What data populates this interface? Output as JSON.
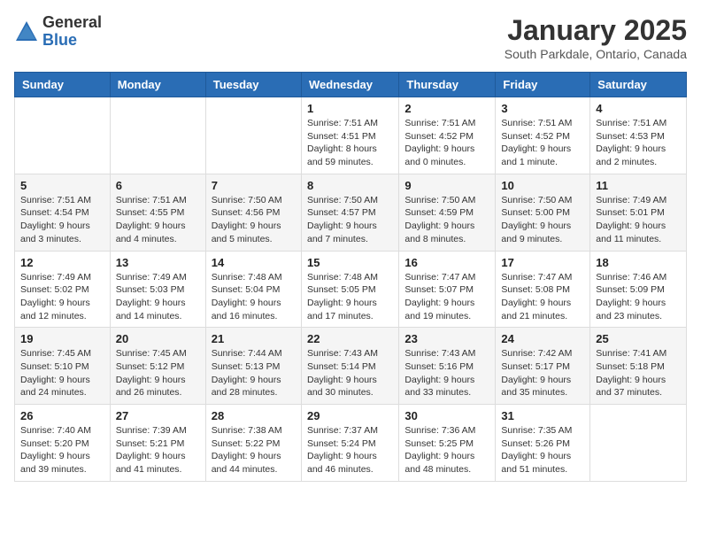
{
  "logo": {
    "general": "General",
    "blue": "Blue"
  },
  "title": "January 2025",
  "location": "South Parkdale, Ontario, Canada",
  "days_of_week": [
    "Sunday",
    "Monday",
    "Tuesday",
    "Wednesday",
    "Thursday",
    "Friday",
    "Saturday"
  ],
  "weeks": [
    [
      {
        "day": "",
        "info": ""
      },
      {
        "day": "",
        "info": ""
      },
      {
        "day": "",
        "info": ""
      },
      {
        "day": "1",
        "info": "Sunrise: 7:51 AM\nSunset: 4:51 PM\nDaylight: 8 hours and 59 minutes."
      },
      {
        "day": "2",
        "info": "Sunrise: 7:51 AM\nSunset: 4:52 PM\nDaylight: 9 hours and 0 minutes."
      },
      {
        "day": "3",
        "info": "Sunrise: 7:51 AM\nSunset: 4:52 PM\nDaylight: 9 hours and 1 minute."
      },
      {
        "day": "4",
        "info": "Sunrise: 7:51 AM\nSunset: 4:53 PM\nDaylight: 9 hours and 2 minutes."
      }
    ],
    [
      {
        "day": "5",
        "info": "Sunrise: 7:51 AM\nSunset: 4:54 PM\nDaylight: 9 hours and 3 minutes."
      },
      {
        "day": "6",
        "info": "Sunrise: 7:51 AM\nSunset: 4:55 PM\nDaylight: 9 hours and 4 minutes."
      },
      {
        "day": "7",
        "info": "Sunrise: 7:50 AM\nSunset: 4:56 PM\nDaylight: 9 hours and 5 minutes."
      },
      {
        "day": "8",
        "info": "Sunrise: 7:50 AM\nSunset: 4:57 PM\nDaylight: 9 hours and 7 minutes."
      },
      {
        "day": "9",
        "info": "Sunrise: 7:50 AM\nSunset: 4:59 PM\nDaylight: 9 hours and 8 minutes."
      },
      {
        "day": "10",
        "info": "Sunrise: 7:50 AM\nSunset: 5:00 PM\nDaylight: 9 hours and 9 minutes."
      },
      {
        "day": "11",
        "info": "Sunrise: 7:49 AM\nSunset: 5:01 PM\nDaylight: 9 hours and 11 minutes."
      }
    ],
    [
      {
        "day": "12",
        "info": "Sunrise: 7:49 AM\nSunset: 5:02 PM\nDaylight: 9 hours and 12 minutes."
      },
      {
        "day": "13",
        "info": "Sunrise: 7:49 AM\nSunset: 5:03 PM\nDaylight: 9 hours and 14 minutes."
      },
      {
        "day": "14",
        "info": "Sunrise: 7:48 AM\nSunset: 5:04 PM\nDaylight: 9 hours and 16 minutes."
      },
      {
        "day": "15",
        "info": "Sunrise: 7:48 AM\nSunset: 5:05 PM\nDaylight: 9 hours and 17 minutes."
      },
      {
        "day": "16",
        "info": "Sunrise: 7:47 AM\nSunset: 5:07 PM\nDaylight: 9 hours and 19 minutes."
      },
      {
        "day": "17",
        "info": "Sunrise: 7:47 AM\nSunset: 5:08 PM\nDaylight: 9 hours and 21 minutes."
      },
      {
        "day": "18",
        "info": "Sunrise: 7:46 AM\nSunset: 5:09 PM\nDaylight: 9 hours and 23 minutes."
      }
    ],
    [
      {
        "day": "19",
        "info": "Sunrise: 7:45 AM\nSunset: 5:10 PM\nDaylight: 9 hours and 24 minutes."
      },
      {
        "day": "20",
        "info": "Sunrise: 7:45 AM\nSunset: 5:12 PM\nDaylight: 9 hours and 26 minutes."
      },
      {
        "day": "21",
        "info": "Sunrise: 7:44 AM\nSunset: 5:13 PM\nDaylight: 9 hours and 28 minutes."
      },
      {
        "day": "22",
        "info": "Sunrise: 7:43 AM\nSunset: 5:14 PM\nDaylight: 9 hours and 30 minutes."
      },
      {
        "day": "23",
        "info": "Sunrise: 7:43 AM\nSunset: 5:16 PM\nDaylight: 9 hours and 33 minutes."
      },
      {
        "day": "24",
        "info": "Sunrise: 7:42 AM\nSunset: 5:17 PM\nDaylight: 9 hours and 35 minutes."
      },
      {
        "day": "25",
        "info": "Sunrise: 7:41 AM\nSunset: 5:18 PM\nDaylight: 9 hours and 37 minutes."
      }
    ],
    [
      {
        "day": "26",
        "info": "Sunrise: 7:40 AM\nSunset: 5:20 PM\nDaylight: 9 hours and 39 minutes."
      },
      {
        "day": "27",
        "info": "Sunrise: 7:39 AM\nSunset: 5:21 PM\nDaylight: 9 hours and 41 minutes."
      },
      {
        "day": "28",
        "info": "Sunrise: 7:38 AM\nSunset: 5:22 PM\nDaylight: 9 hours and 44 minutes."
      },
      {
        "day": "29",
        "info": "Sunrise: 7:37 AM\nSunset: 5:24 PM\nDaylight: 9 hours and 46 minutes."
      },
      {
        "day": "30",
        "info": "Sunrise: 7:36 AM\nSunset: 5:25 PM\nDaylight: 9 hours and 48 minutes."
      },
      {
        "day": "31",
        "info": "Sunrise: 7:35 AM\nSunset: 5:26 PM\nDaylight: 9 hours and 51 minutes."
      },
      {
        "day": "",
        "info": ""
      }
    ]
  ]
}
